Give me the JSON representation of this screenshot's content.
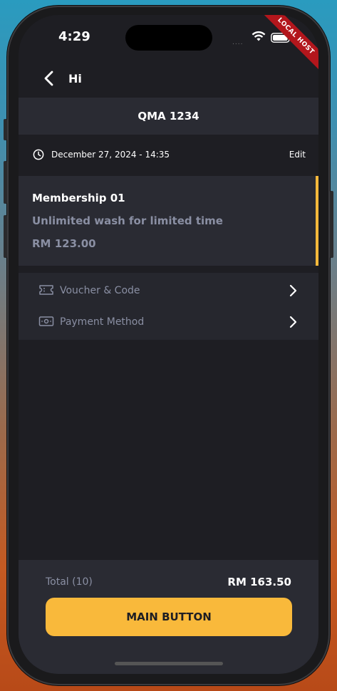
{
  "status": {
    "time": "4:29",
    "signal_dots": "....",
    "debug_ribbon": "LOCAL HOST"
  },
  "nav": {
    "title": "Hi"
  },
  "plate": "QMA 1234",
  "booking": {
    "datetime": "December 27, 2024 - 14:35",
    "edit_label": "Edit"
  },
  "membership": {
    "title": "Membership 01",
    "description": "Unlimited wash for limited time",
    "price": "RM 123.00"
  },
  "options": [
    {
      "label": "Voucher & Code",
      "icon": "ticket-icon"
    },
    {
      "label": "Payment Method",
      "icon": "cash-icon"
    }
  ],
  "footer": {
    "total_label": "Total (10)",
    "total_value": "RM 163.50",
    "button_label": "MAIN BUTTON"
  },
  "colors": {
    "accent": "#f9b93b",
    "surface": "#2a2b33",
    "background": "#1e1e23",
    "muted_text": "#8a8fa3",
    "ribbon": "#b3161c"
  }
}
